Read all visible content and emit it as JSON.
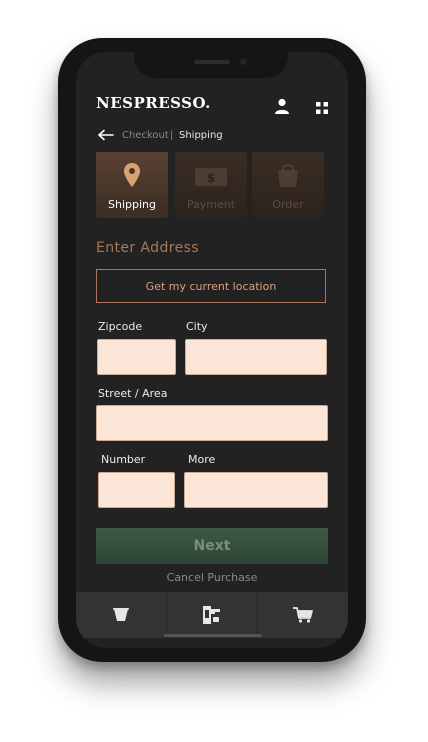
{
  "header": {
    "brand": "NESPRESSO.",
    "user_icon": "user-icon",
    "menu_icon": "grid-menu-icon"
  },
  "breadcrumb": {
    "back_icon": "arrow-left-icon",
    "checkout": "Checkout",
    "separator": "|",
    "current": "Shipping"
  },
  "steps": [
    {
      "label": "Shipping",
      "icon": "location-pin-icon",
      "active": true
    },
    {
      "label": "Payment",
      "icon": "dollar-bill-icon",
      "active": false
    },
    {
      "label": "Order",
      "icon": "shopping-bag-icon",
      "active": false
    }
  ],
  "form": {
    "heading": "Enter Address",
    "location_button": "Get my current location",
    "zipcode_label": "Zipcode",
    "zipcode_value": "",
    "city_label": "City",
    "city_value": "",
    "street_label": "Street / Area",
    "street_value": "",
    "number_label": "Number",
    "number_value": "",
    "more_label": "More",
    "more_value": ""
  },
  "actions": {
    "next": "Next",
    "cancel": "Cancel Purchase"
  },
  "tabbar": [
    {
      "icon": "coffee-capsule-icon"
    },
    {
      "icon": "coffee-machine-icon"
    },
    {
      "icon": "cart-icon"
    }
  ],
  "colors": {
    "accent": "#a9775a",
    "field_bg": "#fbe5d6",
    "screen_bg": "#222222",
    "next_bg": "#3d5a46"
  }
}
